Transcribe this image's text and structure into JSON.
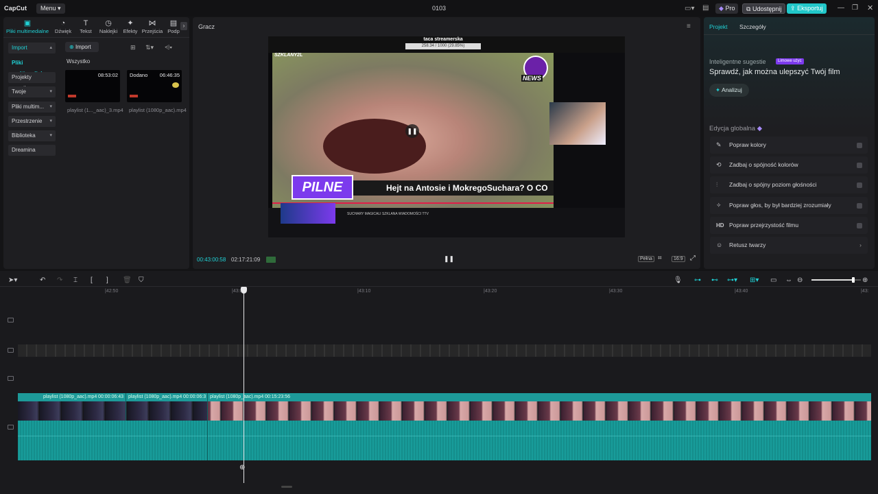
{
  "titlebar": {
    "app_name": "CapCut",
    "menu_label": "Menu",
    "project_name": "0103",
    "pro_label": "Pro",
    "share_label": "Udostępnij",
    "export_label": "Eksportuj"
  },
  "toolstrip": [
    {
      "label": "Pliki multimedialne",
      "icon": "media-icon",
      "glyph": "▣"
    },
    {
      "label": "Dźwięk",
      "icon": "audio-icon",
      "glyph": "◔"
    },
    {
      "label": "Tekst",
      "icon": "text-icon",
      "glyph": "T"
    },
    {
      "label": "Naklejki",
      "icon": "sticker-icon",
      "glyph": "◷"
    },
    {
      "label": "Efekty",
      "icon": "effects-icon",
      "glyph": "✦"
    },
    {
      "label": "Przejścia",
      "icon": "transitions-icon",
      "glyph": "⋈"
    },
    {
      "label": "Podp",
      "icon": "captions-icon",
      "glyph": "▤"
    }
  ],
  "sidebar": {
    "items": [
      {
        "label": "Import"
      },
      {
        "label": "Pliki multimedial..."
      },
      {
        "label": "Projekty cząstko..."
      },
      {
        "label": "Twoje"
      },
      {
        "label": "Pliki multim..."
      },
      {
        "label": "Przestrzenie"
      },
      {
        "label": "Biblioteka"
      },
      {
        "label": "Dreamina"
      }
    ]
  },
  "media": {
    "import_label": "Import",
    "filter_label": "Wszystko",
    "items": [
      {
        "duration": "08:53:02",
        "name": "playlist (1..._aac)_3.mp4",
        "badge": ""
      },
      {
        "duration": "06:46:35",
        "name": "playlist (1080p_aac).mp4",
        "badge": "Dodano"
      }
    ]
  },
  "player": {
    "title": "Gracz",
    "current_time": "00:43:00:58",
    "total_time": "02:17:21:09",
    "full_label": "Pełna",
    "ratio_label": "16:9",
    "overlay": {
      "top_title": "taca streamerska",
      "top_sub": "258.34 / 1000 (29.85%)",
      "channel_tag": "SZKLANY2L",
      "news_label": "NEWS",
      "pilne": "PILNE",
      "headline": "Hejt na Antosie i MokregoSuchara? O CO",
      "bottom_text": "SUCHARY MAGICALI SZKLANA WIADOMOŚCI TTV"
    }
  },
  "right_panel": {
    "tab_project": "Projekt",
    "tab_details": "Szczegóły",
    "suggest_label": "Inteligentne sugestie",
    "suggest_badge": "Limowe użyc",
    "suggest_title": "Sprawdź, jak można ulepszyć Twój film",
    "analyze_label": "Analizuj",
    "global_label": "Edycja globalna",
    "items": [
      {
        "label": "Popraw kolory",
        "icon": "color-wand-icon",
        "glyph": "✎"
      },
      {
        "label": "Zadbaj o spójność kolorów",
        "icon": "color-match-icon",
        "glyph": "⟲"
      },
      {
        "label": "Zadbaj o spójny poziom głośności",
        "icon": "volume-level-icon",
        "glyph": "⫶"
      },
      {
        "label": "Popraw głos, by był bardziej zrozumiały",
        "icon": "voice-enhance-icon",
        "glyph": "✧"
      },
      {
        "label": "Popraw przejrzystość filmu",
        "icon": "hd-icon",
        "glyph": "HD"
      },
      {
        "label": "Retusz twarzy",
        "icon": "face-retouch-icon",
        "glyph": "☺"
      }
    ]
  },
  "timeline": {
    "ruler": [
      "|42:50",
      "|43:00",
      "|43:10",
      "|43:20",
      "|43:30",
      "|43:40",
      "|43:"
    ],
    "clips": [
      {
        "name": "playlist (1080p_aac).mp4",
        "time": "00:00:06:43"
      },
      {
        "name": "playlist (1080p_aac).mp4",
        "time": "00:00:06:3"
      },
      {
        "name": "playlist (1080p_aac).mp4",
        "time": "00:15:23:56"
      }
    ],
    "zoom_level": 0.85
  },
  "colors": {
    "accent": "#20d2d6",
    "track": "#1d9a99",
    "export": "#21c7c9"
  }
}
